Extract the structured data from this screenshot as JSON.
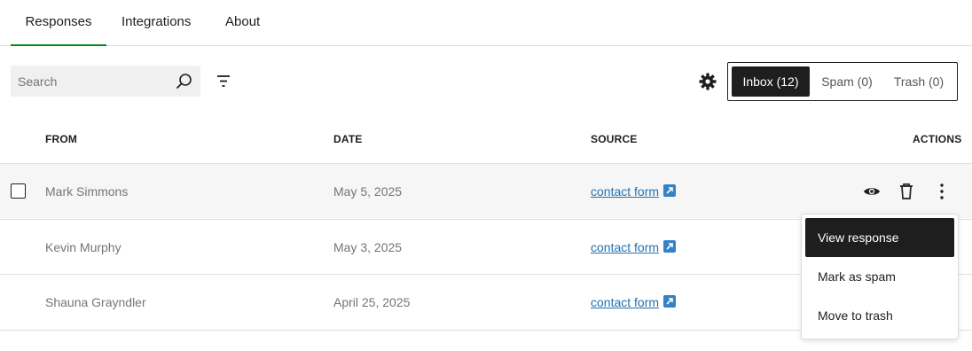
{
  "tabs": [
    {
      "label": "Responses",
      "active": true
    },
    {
      "label": "Integrations",
      "active": false
    },
    {
      "label": "About",
      "active": false
    }
  ],
  "toolbar": {
    "search_placeholder": "Search",
    "search_icon": "search-icon",
    "filter_icon": "filter-icon",
    "settings_icon": "gear-icon"
  },
  "folders": [
    {
      "label": "Inbox (12)",
      "active": true
    },
    {
      "label": "Spam (0)",
      "active": false
    },
    {
      "label": "Trash (0)",
      "active": false
    }
  ],
  "table": {
    "columns": [
      "FROM",
      "DATE",
      "SOURCE",
      "ACTIONS"
    ],
    "rows": [
      {
        "from": "Mark Simmons",
        "date": "May 5, 2025",
        "source": "contact form"
      },
      {
        "from": "Kevin Murphy",
        "date": "May 3, 2025",
        "source": "contact form"
      },
      {
        "from": "Shauna Grayndler",
        "date": "April 25, 2025",
        "source": "contact form"
      }
    ]
  },
  "row_actions": [
    "view-icon",
    "trash-icon",
    "more-vertical-icon"
  ],
  "action_menu": {
    "items": [
      "View response",
      "Mark as spam",
      "Move to trash"
    ]
  },
  "colors": {
    "accent": "#008a20",
    "link": "#2271b1",
    "dark": "#1e1e1e"
  }
}
